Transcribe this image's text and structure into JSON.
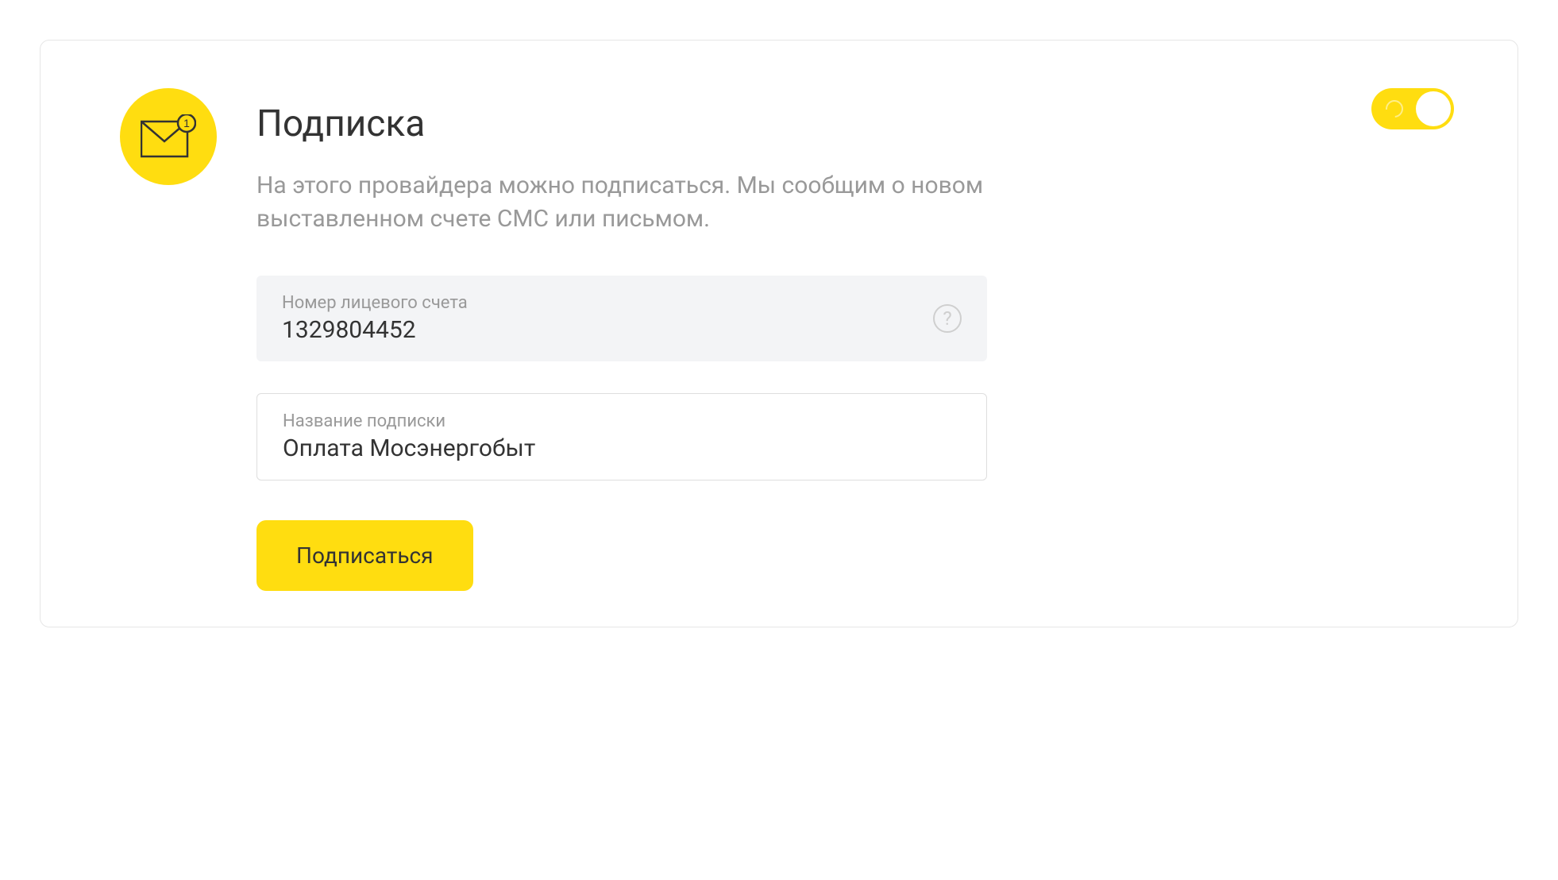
{
  "card": {
    "title": "Подписка",
    "description": "На этого провайдера можно подписаться. Мы сообщим о новом выставленном счете СМС или письмом.",
    "toggle_on": true
  },
  "fields": {
    "account": {
      "label": "Номер лицевого счета",
      "value": "1329804452"
    },
    "subscription_name": {
      "label": "Название подписки",
      "value": "Оплата Мосэнергобыт"
    }
  },
  "actions": {
    "subscribe_label": "Подписаться"
  },
  "help_glyph": "?",
  "colors": {
    "accent": "#ffdd10",
    "text_primary": "#333333",
    "text_secondary": "#999999",
    "readonly_bg": "#f3f4f6",
    "border": "#dedede"
  }
}
